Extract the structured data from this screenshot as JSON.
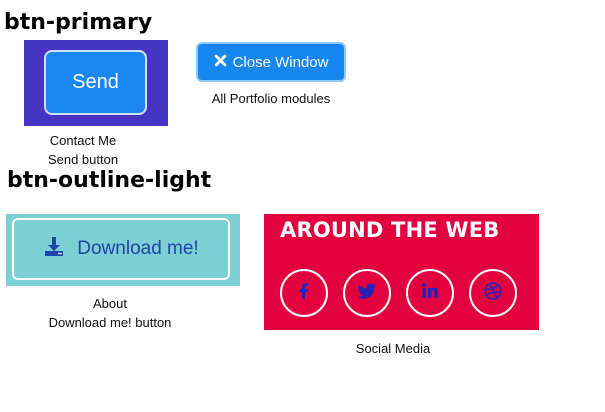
{
  "sections": {
    "primary_heading": "btn-primary",
    "outline_heading": "btn-outline-light"
  },
  "send": {
    "button_label": "Send",
    "caption_line1": "Contact Me",
    "caption_line2": "Send button"
  },
  "close_window": {
    "button_label": "Close Window",
    "caption": "All Portfolio modules"
  },
  "download": {
    "button_label": "Download me!",
    "caption_line1": "About",
    "caption_line2": "Download me! button"
  },
  "social": {
    "title": "AROUND THE WEB",
    "caption": "Social Media",
    "icons": [
      "facebook-icon",
      "twitter-icon",
      "linkedin-icon",
      "dribbble-icon"
    ]
  },
  "colors": {
    "send_panel_bg": "#4635c4",
    "primary_blue": "#1b87f2",
    "download_panel_bg": "#7ccfd3",
    "download_text": "#1f44a8",
    "social_panel_bg": "#e3003f",
    "social_icon": "#2a1fb8"
  }
}
